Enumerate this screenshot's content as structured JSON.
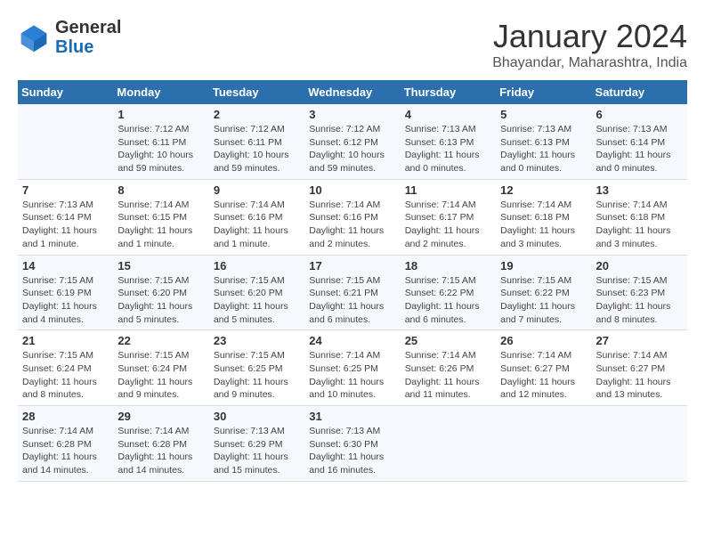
{
  "header": {
    "logo": {
      "general": "General",
      "blue": "Blue"
    },
    "title": "January 2024",
    "location": "Bhayandar, Maharashtra, India"
  },
  "days_of_week": [
    "Sunday",
    "Monday",
    "Tuesday",
    "Wednesday",
    "Thursday",
    "Friday",
    "Saturday"
  ],
  "weeks": [
    [
      {
        "day": "",
        "info": ""
      },
      {
        "day": "1",
        "info": "Sunrise: 7:12 AM\nSunset: 6:11 PM\nDaylight: 10 hours and 59 minutes."
      },
      {
        "day": "2",
        "info": "Sunrise: 7:12 AM\nSunset: 6:11 PM\nDaylight: 10 hours and 59 minutes."
      },
      {
        "day": "3",
        "info": "Sunrise: 7:12 AM\nSunset: 6:12 PM\nDaylight: 10 hours and 59 minutes."
      },
      {
        "day": "4",
        "info": "Sunrise: 7:13 AM\nSunset: 6:13 PM\nDaylight: 11 hours and 0 minutes."
      },
      {
        "day": "5",
        "info": "Sunrise: 7:13 AM\nSunset: 6:13 PM\nDaylight: 11 hours and 0 minutes."
      },
      {
        "day": "6",
        "info": "Sunrise: 7:13 AM\nSunset: 6:14 PM\nDaylight: 11 hours and 0 minutes."
      }
    ],
    [
      {
        "day": "7",
        "info": "Sunrise: 7:13 AM\nSunset: 6:14 PM\nDaylight: 11 hours and 1 minute."
      },
      {
        "day": "8",
        "info": "Sunrise: 7:14 AM\nSunset: 6:15 PM\nDaylight: 11 hours and 1 minute."
      },
      {
        "day": "9",
        "info": "Sunrise: 7:14 AM\nSunset: 6:16 PM\nDaylight: 11 hours and 1 minute."
      },
      {
        "day": "10",
        "info": "Sunrise: 7:14 AM\nSunset: 6:16 PM\nDaylight: 11 hours and 2 minutes."
      },
      {
        "day": "11",
        "info": "Sunrise: 7:14 AM\nSunset: 6:17 PM\nDaylight: 11 hours and 2 minutes."
      },
      {
        "day": "12",
        "info": "Sunrise: 7:14 AM\nSunset: 6:18 PM\nDaylight: 11 hours and 3 minutes."
      },
      {
        "day": "13",
        "info": "Sunrise: 7:14 AM\nSunset: 6:18 PM\nDaylight: 11 hours and 3 minutes."
      }
    ],
    [
      {
        "day": "14",
        "info": "Sunrise: 7:15 AM\nSunset: 6:19 PM\nDaylight: 11 hours and 4 minutes."
      },
      {
        "day": "15",
        "info": "Sunrise: 7:15 AM\nSunset: 6:20 PM\nDaylight: 11 hours and 5 minutes."
      },
      {
        "day": "16",
        "info": "Sunrise: 7:15 AM\nSunset: 6:20 PM\nDaylight: 11 hours and 5 minutes."
      },
      {
        "day": "17",
        "info": "Sunrise: 7:15 AM\nSunset: 6:21 PM\nDaylight: 11 hours and 6 minutes."
      },
      {
        "day": "18",
        "info": "Sunrise: 7:15 AM\nSunset: 6:22 PM\nDaylight: 11 hours and 6 minutes."
      },
      {
        "day": "19",
        "info": "Sunrise: 7:15 AM\nSunset: 6:22 PM\nDaylight: 11 hours and 7 minutes."
      },
      {
        "day": "20",
        "info": "Sunrise: 7:15 AM\nSunset: 6:23 PM\nDaylight: 11 hours and 8 minutes."
      }
    ],
    [
      {
        "day": "21",
        "info": "Sunrise: 7:15 AM\nSunset: 6:24 PM\nDaylight: 11 hours and 8 minutes."
      },
      {
        "day": "22",
        "info": "Sunrise: 7:15 AM\nSunset: 6:24 PM\nDaylight: 11 hours and 9 minutes."
      },
      {
        "day": "23",
        "info": "Sunrise: 7:15 AM\nSunset: 6:25 PM\nDaylight: 11 hours and 9 minutes."
      },
      {
        "day": "24",
        "info": "Sunrise: 7:14 AM\nSunset: 6:25 PM\nDaylight: 11 hours and 10 minutes."
      },
      {
        "day": "25",
        "info": "Sunrise: 7:14 AM\nSunset: 6:26 PM\nDaylight: 11 hours and 11 minutes."
      },
      {
        "day": "26",
        "info": "Sunrise: 7:14 AM\nSunset: 6:27 PM\nDaylight: 11 hours and 12 minutes."
      },
      {
        "day": "27",
        "info": "Sunrise: 7:14 AM\nSunset: 6:27 PM\nDaylight: 11 hours and 13 minutes."
      }
    ],
    [
      {
        "day": "28",
        "info": "Sunrise: 7:14 AM\nSunset: 6:28 PM\nDaylight: 11 hours and 14 minutes."
      },
      {
        "day": "29",
        "info": "Sunrise: 7:14 AM\nSunset: 6:28 PM\nDaylight: 11 hours and 14 minutes."
      },
      {
        "day": "30",
        "info": "Sunrise: 7:13 AM\nSunset: 6:29 PM\nDaylight: 11 hours and 15 minutes."
      },
      {
        "day": "31",
        "info": "Sunrise: 7:13 AM\nSunset: 6:30 PM\nDaylight: 11 hours and 16 minutes."
      },
      {
        "day": "",
        "info": ""
      },
      {
        "day": "",
        "info": ""
      },
      {
        "day": "",
        "info": ""
      }
    ]
  ]
}
